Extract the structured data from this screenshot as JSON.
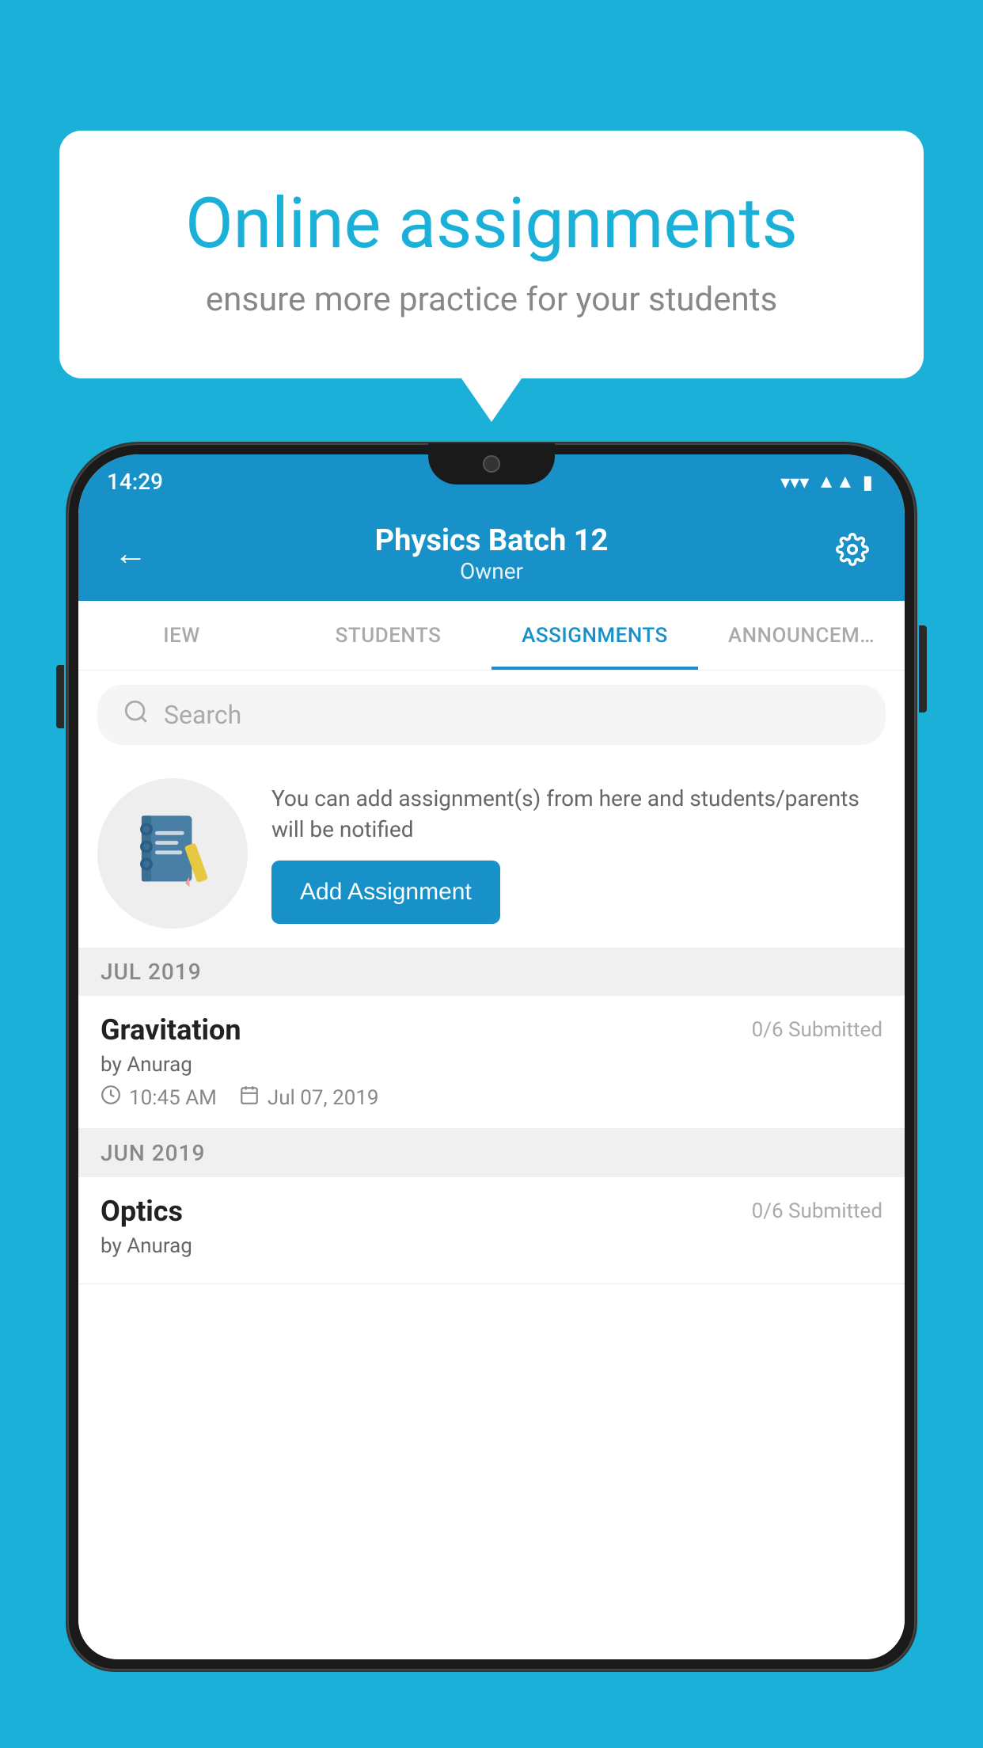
{
  "background": {
    "color": "#1ab0d8"
  },
  "speech_bubble": {
    "title": "Online assignments",
    "subtitle": "ensure more practice for your students"
  },
  "status_bar": {
    "time": "14:29",
    "wifi": "▾",
    "signal": "▲",
    "battery": "▮"
  },
  "app_bar": {
    "title": "Physics Batch 12",
    "subtitle": "Owner",
    "back_label": "←",
    "settings_label": "⚙"
  },
  "tabs": [
    {
      "label": "IEW",
      "active": false
    },
    {
      "label": "STUDENTS",
      "active": false
    },
    {
      "label": "ASSIGNMENTS",
      "active": true
    },
    {
      "label": "ANNOUNCEM…",
      "active": false
    }
  ],
  "search": {
    "placeholder": "Search"
  },
  "promo": {
    "text": "You can add assignment(s) from here and students/parents will be notified",
    "button_label": "Add Assignment"
  },
  "sections": [
    {
      "header": "JUL 2019",
      "assignments": [
        {
          "title": "Gravitation",
          "submitted": "0/6 Submitted",
          "author": "by Anurag",
          "time": "10:45 AM",
          "date": "Jul 07, 2019"
        }
      ]
    },
    {
      "header": "JUN 2019",
      "assignments": [
        {
          "title": "Optics",
          "submitted": "0/6 Submitted",
          "author": "by Anurag",
          "time": "",
          "date": ""
        }
      ]
    }
  ]
}
